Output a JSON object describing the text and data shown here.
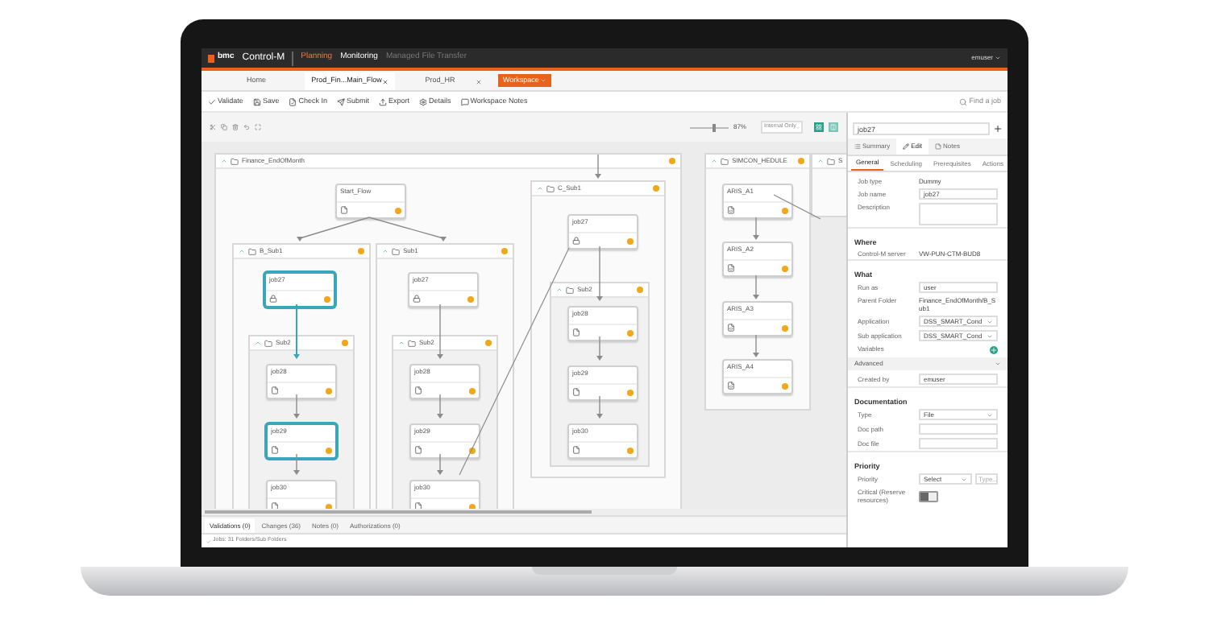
{
  "app": {
    "brand": "bmc",
    "product": "Control-M",
    "nav": [
      {
        "label": "Planning",
        "selected": true
      },
      {
        "label": "Monitoring",
        "selected": false
      },
      {
        "label": "Managed File Transfer",
        "selected": false
      }
    ],
    "user": "emuser"
  },
  "doc_tabs": [
    {
      "label": "Home",
      "closable": false,
      "selected": false
    },
    {
      "label": "Prod_Fin...Main_Flow",
      "closable": true,
      "selected": true
    },
    {
      "label": "Prod_HR",
      "closable": true,
      "selected": false
    }
  ],
  "workspace_button": "Workspace",
  "toolbar": [
    {
      "label": "Validate",
      "kind": "check"
    },
    {
      "label": "Save",
      "kind": "save"
    },
    {
      "label": "Check In",
      "kind": "checkin"
    },
    {
      "label": "Submit",
      "kind": "submit"
    },
    {
      "label": "Export",
      "kind": "export"
    },
    {
      "label": "Details",
      "kind": "details"
    },
    {
      "label": "Workspace Notes",
      "kind": "notes"
    }
  ],
  "search": {
    "placeholder": "Find a job"
  },
  "zoom": {
    "level": 0.6,
    "reading": "87%"
  },
  "view_select": "Internal Only",
  "canvas": {
    "main_folder": "Finance_EndOfMonth",
    "start_job": {
      "name": "Start_Flow",
      "kind": "file",
      "selected": false
    },
    "subfolders": [
      {
        "name": "B_Sub1",
        "job": {
          "name": "job27",
          "kind": "lock",
          "selected": true
        },
        "inner": {
          "name": "Sub2",
          "jobs": [
            {
              "name": "job28",
              "kind": "file",
              "selected": false
            },
            {
              "name": "job29",
              "kind": "file",
              "selected": true
            },
            {
              "name": "job30",
              "kind": "file",
              "selected": false
            }
          ]
        }
      },
      {
        "name": "Sub1",
        "job": {
          "name": "job27",
          "kind": "lock",
          "selected": false
        },
        "inner": {
          "name": "Sub2",
          "jobs": [
            {
              "name": "job28",
              "kind": "file",
              "selected": false
            },
            {
              "name": "job29",
              "kind": "file",
              "selected": false
            },
            {
              "name": "job30",
              "kind": "file",
              "selected": false
            }
          ]
        }
      },
      {
        "name": "C_Sub1",
        "job": {
          "name": "job27",
          "kind": "lock",
          "selected": false
        },
        "inner": {
          "name": "Sub2",
          "jobs": [
            {
              "name": "job28",
              "kind": "file",
              "selected": false
            },
            {
              "name": "job29",
              "kind": "file",
              "selected": false
            },
            {
              "name": "job30",
              "kind": "file",
              "selected": false
            }
          ]
        }
      }
    ],
    "side_folder": {
      "name": "SIMCON_HEDULE",
      "jobs": [
        {
          "name": "ARIS_A1",
          "kind": "script",
          "selected": false
        },
        {
          "name": "ARIS_A2",
          "kind": "script",
          "selected": false
        },
        {
          "name": "ARIS_A3",
          "kind": "script",
          "selected": false
        },
        {
          "name": "ARIS_A4",
          "kind": "script",
          "selected": false
        }
      ]
    },
    "partial_folder": "S"
  },
  "bottom_tabs": [
    {
      "label": "Validations (0)",
      "selected": true
    },
    {
      "label": "Changes (36)",
      "selected": false
    },
    {
      "label": "Notes (0)",
      "selected": false
    },
    {
      "label": "Authorizations (0)",
      "selected": false
    }
  ],
  "status": "Jobs: 31 Folders/Sub Folders",
  "panel": {
    "job_field": "job27",
    "tabs": [
      {
        "label": "Summary",
        "kind": "list",
        "selected": false
      },
      {
        "label": "Edit",
        "kind": "edit",
        "selected": true
      },
      {
        "label": "Notes",
        "kind": "note",
        "selected": false
      }
    ],
    "subtabs": [
      {
        "label": "General",
        "selected": true
      },
      {
        "label": "Scheduling",
        "selected": false
      },
      {
        "label": "Prerequisites",
        "selected": false
      },
      {
        "label": "Actions",
        "selected": false
      }
    ],
    "rows": [
      {
        "kind": "value",
        "label": "Job type",
        "value": "Dummy"
      },
      {
        "kind": "input",
        "label": "Job name",
        "value": "job27"
      },
      {
        "kind": "textarea",
        "label": "Description"
      },
      {
        "kind": "heading",
        "label": "Where"
      },
      {
        "kind": "value",
        "label": "Control-M server",
        "value": "VW-PUN-CTM-BUD8"
      },
      {
        "kind": "heading",
        "label": "What"
      },
      {
        "kind": "input",
        "label": "Run as",
        "value": "user"
      },
      {
        "kind": "value",
        "label": "Parent Folder",
        "value": "Finance_EndOfMonth/B_Sub1"
      },
      {
        "kind": "select",
        "label": "Application",
        "value": "DSS_SMART_Cond"
      },
      {
        "kind": "select",
        "label": "Sub application",
        "value": "DSS_SMART_Cond"
      },
      {
        "kind": "add",
        "label": "Variables"
      },
      {
        "kind": "section",
        "label": "Advanced"
      },
      {
        "kind": "input",
        "label": "Created by",
        "value": "emuser"
      },
      {
        "kind": "heading",
        "label": "Documentation"
      },
      {
        "kind": "select",
        "label": "Type",
        "value": "File"
      },
      {
        "kind": "input",
        "label": "Doc path"
      },
      {
        "kind": "input",
        "label": "Doc file"
      },
      {
        "kind": "heading",
        "label": "Priority"
      },
      {
        "kind": "priority",
        "label": "Priority",
        "value": "Select",
        "placeholder": "Type..."
      },
      {
        "kind": "toggle",
        "label": "Critical (Reserve resources)",
        "on": false
      }
    ]
  }
}
